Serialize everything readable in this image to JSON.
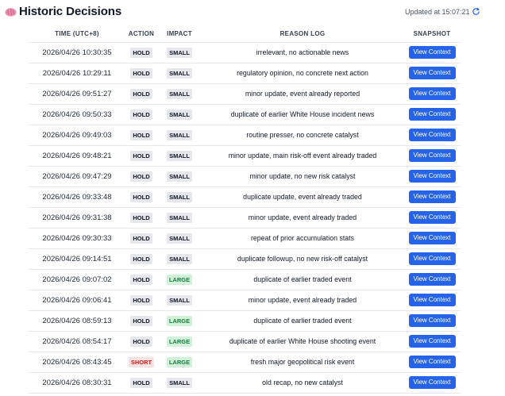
{
  "header": {
    "title": "Historic Decisions",
    "updated": "Updated at 15:07:21"
  },
  "columns": {
    "time": "TIME (UTC+8)",
    "action": "ACTION",
    "impact": "IMPACT",
    "reason": "REASON LOG",
    "snapshot": "SNAPSHOT"
  },
  "button_label": "View Context",
  "colors": {
    "accent": "#2563eb",
    "short": "#c81e1e",
    "large": "#15803d"
  },
  "rows": [
    {
      "time": "2026/04/26 10:30:35",
      "action": "HOLD",
      "impact": "SMALL",
      "reason": "irrelevant, no actionable news"
    },
    {
      "time": "2026/04/26 10:29:11",
      "action": "HOLD",
      "impact": "SMALL",
      "reason": "regulatory opinion, no concrete next action"
    },
    {
      "time": "2026/04/26 09:51:27",
      "action": "HOLD",
      "impact": "SMALL",
      "reason": "minor update, event already reported"
    },
    {
      "time": "2026/04/26 09:50:33",
      "action": "HOLD",
      "impact": "SMALL",
      "reason": "duplicate of earlier White House incident news"
    },
    {
      "time": "2026/04/26 09:49:03",
      "action": "HOLD",
      "impact": "SMALL",
      "reason": "routine presser, no concrete catalyst"
    },
    {
      "time": "2026/04/26 09:48:21",
      "action": "HOLD",
      "impact": "SMALL",
      "reason": "minor update, main risk-off event already traded"
    },
    {
      "time": "2026/04/26 09:47:29",
      "action": "HOLD",
      "impact": "SMALL",
      "reason": "minor update, no new risk catalyst"
    },
    {
      "time": "2026/04/26 09:33:48",
      "action": "HOLD",
      "impact": "SMALL",
      "reason": "duplicate update, event already traded"
    },
    {
      "time": "2026/04/26 09:31:38",
      "action": "HOLD",
      "impact": "SMALL",
      "reason": "minor update, event already traded"
    },
    {
      "time": "2026/04/26 09:30:33",
      "action": "HOLD",
      "impact": "SMALL",
      "reason": "repeat of prior accumulation stats"
    },
    {
      "time": "2026/04/26 09:14:51",
      "action": "HOLD",
      "impact": "SMALL",
      "reason": "duplicate followup, no new risk-off catalyst"
    },
    {
      "time": "2026/04/26 09:07:02",
      "action": "HOLD",
      "impact": "LARGE",
      "reason": "duplicate of earlier traded event"
    },
    {
      "time": "2026/04/26 09:06:41",
      "action": "HOLD",
      "impact": "SMALL",
      "reason": "minor update, event already traded"
    },
    {
      "time": "2026/04/26 08:59:13",
      "action": "HOLD",
      "impact": "LARGE",
      "reason": "duplicate of earlier traded event"
    },
    {
      "time": "2026/04/26 08:54:17",
      "action": "HOLD",
      "impact": "LARGE",
      "reason": "duplicate of earlier White House shooting event"
    },
    {
      "time": "2026/04/26 08:43:45",
      "action": "SHORT",
      "impact": "LARGE",
      "reason": "fresh major geopolitical risk event"
    },
    {
      "time": "2026/04/26 08:30:31",
      "action": "HOLD",
      "impact": "SMALL",
      "reason": "old recap, no new catalyst"
    }
  ]
}
